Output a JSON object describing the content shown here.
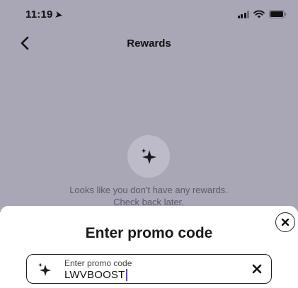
{
  "status_bar": {
    "time": "11:19",
    "location_glyph": "➤"
  },
  "nav": {
    "title": "Rewards",
    "back_icon": "chevron-left-icon"
  },
  "empty_state": {
    "icon": "sparkle-icon",
    "message": "Looks like you don't have any rewards. Check back later."
  },
  "promo_sheet": {
    "title": "Enter promo code",
    "close_icon": "close-icon",
    "field": {
      "label": "Enter promo code",
      "value": "LWVBOOST",
      "leading_icon": "sparkle-icon",
      "clear_icon": "clear-icon"
    }
  },
  "colors": {
    "backdrop": "#a9a6b6",
    "badge": "#bebbc9",
    "caret": "#6a3fd6"
  }
}
